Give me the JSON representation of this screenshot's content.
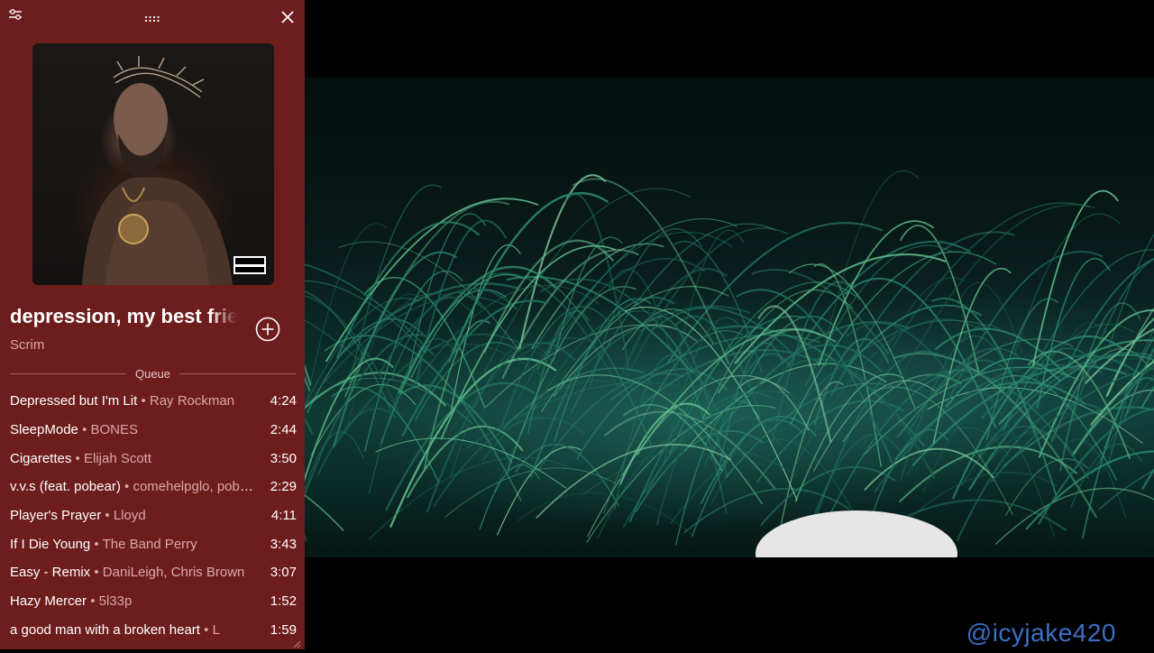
{
  "window": {
    "settings_icon": "sliders-icon",
    "drag_icon": "drag-dots-icon",
    "close_icon": "close-icon"
  },
  "now_playing": {
    "title": "depression, my best friend",
    "artist": "Scrim",
    "add_icon": "plus-circle-icon",
    "cover_badge": "PARENTAL ADVISORY EXPLICIT CONTENT"
  },
  "queue": {
    "label": "Queue",
    "items": [
      {
        "title": "Depressed but I'm Lit",
        "artist": "Ray Rockman",
        "duration": "4:24"
      },
      {
        "title": "SleepMode",
        "artist": "BONES",
        "duration": "2:44"
      },
      {
        "title": "Cigarettes",
        "artist": "Elijah Scott",
        "duration": "3:50"
      },
      {
        "title": "v.v.s (feat. pobear)",
        "artist": "comehelpglo, pobear",
        "duration": "2:29"
      },
      {
        "title": "Player's Prayer",
        "artist": "Lloyd",
        "duration": "4:11"
      },
      {
        "title": "If I Die Young",
        "artist": "The Band Perry",
        "duration": "3:43"
      },
      {
        "title": "Easy - Remix",
        "artist": "DaniLeigh, Chris Brown",
        "duration": "3:07"
      },
      {
        "title": "Hazy Mercer",
        "artist": "5l33p",
        "duration": "1:52"
      },
      {
        "title": "a good man with a broken heart",
        "artist": "L",
        "duration": "1:59"
      }
    ],
    "separator": "•"
  },
  "watermark": "@icyjake420",
  "colors": {
    "panel_bg": "#6e1d1d",
    "muted_text": "#d9a8a8",
    "watermark": "#3d6fc4"
  }
}
